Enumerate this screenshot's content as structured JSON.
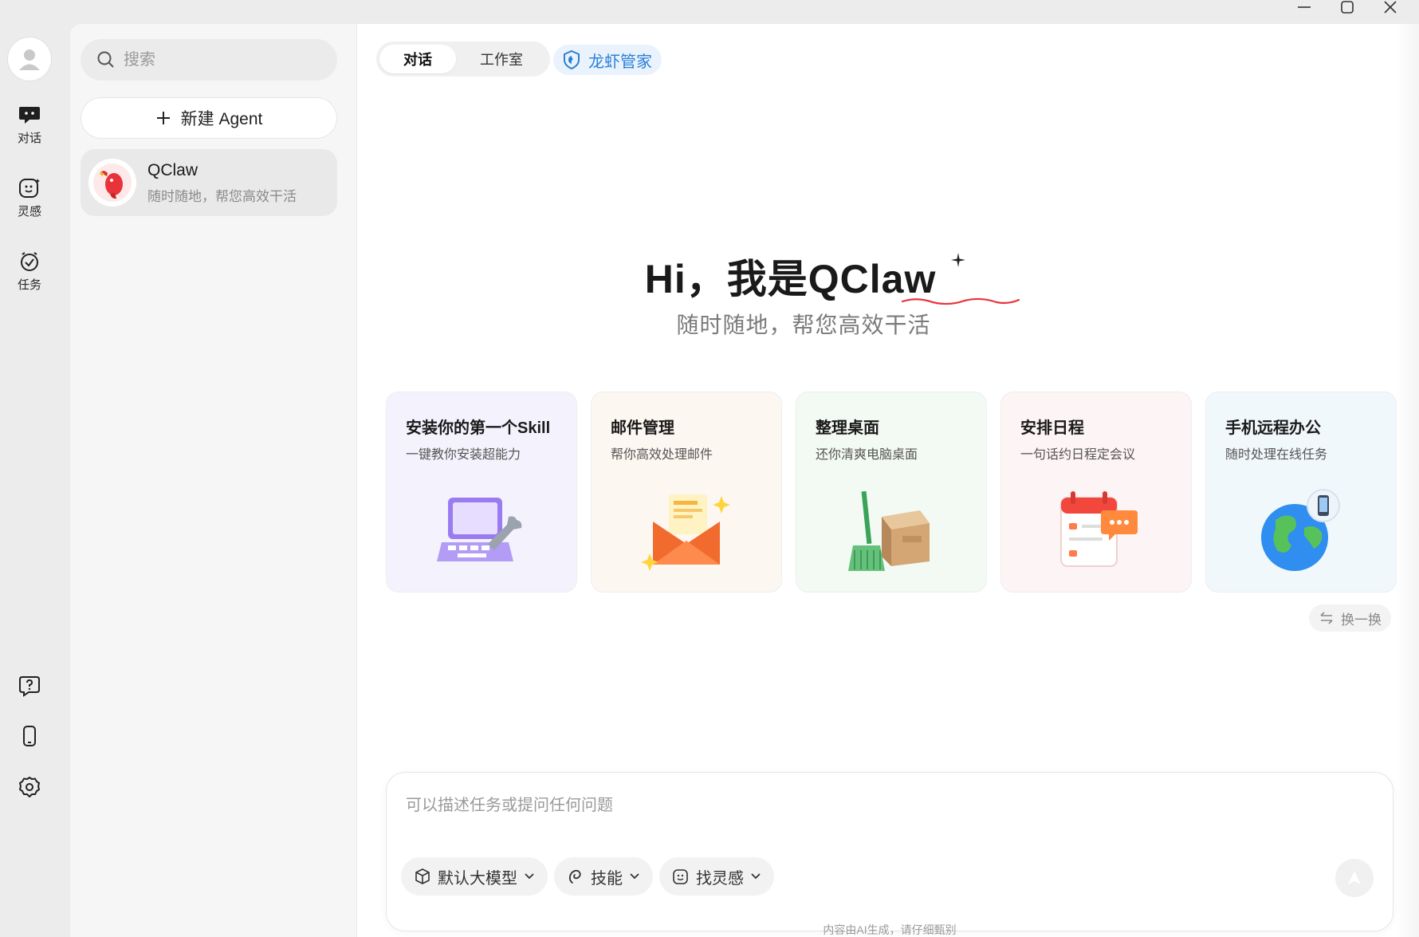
{
  "window": {
    "title": "QClaw"
  },
  "rail": {
    "items": [
      {
        "label": "对话",
        "icon": "chat-icon"
      },
      {
        "label": "灵感",
        "icon": "inspiration-icon"
      },
      {
        "label": "任务",
        "icon": "task-icon"
      }
    ],
    "bottom": [
      "help-icon",
      "phone-icon",
      "settings-icon"
    ]
  },
  "sidebar": {
    "search_placeholder": "搜索",
    "new_agent_label": "新建 Agent",
    "agents": [
      {
        "name": "QClaw",
        "desc": "随时随地，帮您高效干活"
      }
    ]
  },
  "header": {
    "tabs": [
      {
        "label": "对话",
        "active": true
      },
      {
        "label": "工作室",
        "active": false
      }
    ],
    "butler_label": "龙虾管家"
  },
  "hero": {
    "title": "Hi，我是QClaw",
    "subtitle": "随时随地，帮您高效干活"
  },
  "cards": [
    {
      "title": "安装你的第一个Skill",
      "desc": "一键教你安装超能力",
      "icon": "laptop-wrench-icon"
    },
    {
      "title": "邮件管理",
      "desc": "帮你高效处理邮件",
      "icon": "envelope-icon"
    },
    {
      "title": "整理桌面",
      "desc": "还你清爽电脑桌面",
      "icon": "broom-box-icon"
    },
    {
      "title": "安排日程",
      "desc": "一句话约日程定会议",
      "icon": "calendar-icon"
    },
    {
      "title": "手机远程办公",
      "desc": "随时处理在线任务",
      "icon": "globe-phone-icon"
    }
  ],
  "refresh_label": "换一换",
  "composer": {
    "placeholder": "可以描述任务或提问任何问题",
    "chips": [
      {
        "label": "默认大模型",
        "icon": "cube-icon"
      },
      {
        "label": "技能",
        "icon": "skill-icon"
      },
      {
        "label": "找灵感",
        "icon": "inspiration-icon"
      }
    ]
  },
  "disclaimer": "内容由AI生成，请仔细甄别",
  "colors": {
    "accent": "#2a7fd6",
    "brand_red": "#e8333a"
  }
}
